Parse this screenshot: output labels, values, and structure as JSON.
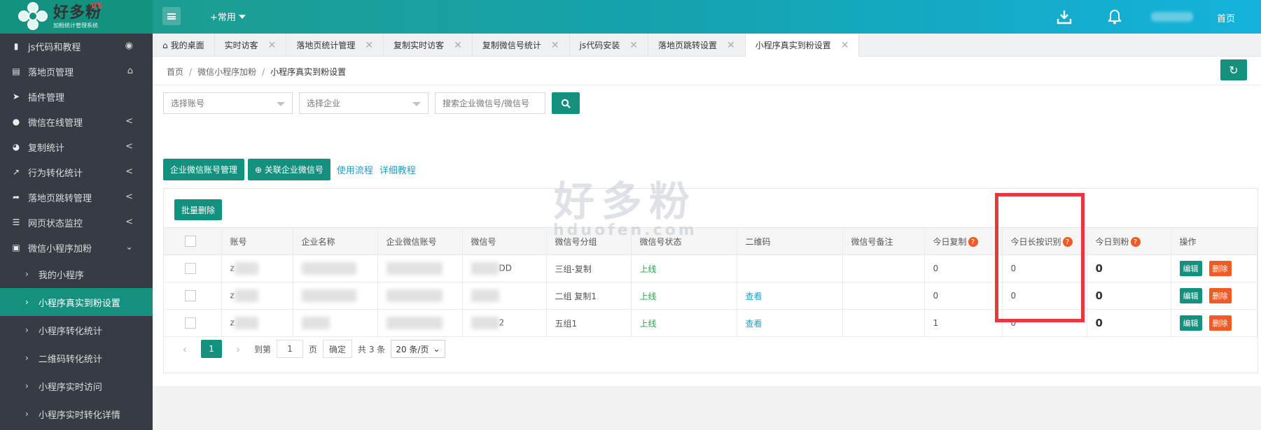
{
  "app": {
    "logo_text": "好多粉",
    "logo_subtitle": "加粉统计管理系统",
    "version": "V5",
    "quick_menu": "+常用",
    "home": "首页"
  },
  "sidebar": {
    "items": [
      {
        "label": "js代码和教程",
        "icon": "bookmark-icon",
        "right": "eye-icon"
      },
      {
        "label": "落地页管理",
        "icon": "page-icon",
        "right": "home-icon"
      },
      {
        "label": "插件管理",
        "icon": "paper-plane-icon"
      },
      {
        "label": "微信在线管理",
        "icon": "wechat-icon",
        "right": "<"
      },
      {
        "label": "复制统计",
        "icon": "pie-chart-icon",
        "right": "<"
      },
      {
        "label": "行为转化统计",
        "icon": "line-chart-icon",
        "right": "<"
      },
      {
        "label": "落地页跳转管理",
        "icon": "share-icon",
        "right": "<"
      },
      {
        "label": "网页状态监控",
        "icon": "list-icon",
        "right": "<"
      },
      {
        "label": "微信小程序加粉",
        "icon": "mini-program-icon",
        "right": "⌄"
      }
    ],
    "subitems": [
      {
        "label": "我的小程序",
        "active": false
      },
      {
        "label": "小程序真实到粉设置",
        "active": true
      },
      {
        "label": "小程序转化统计",
        "active": false
      },
      {
        "label": "二维码转化统计",
        "active": false
      },
      {
        "label": "小程序实时访问",
        "active": false
      },
      {
        "label": "小程序实时转化详情",
        "active": false
      }
    ]
  },
  "tabs": [
    {
      "label": "我的桌面",
      "closable": false
    },
    {
      "label": "实时访客",
      "closable": true
    },
    {
      "label": "落地页统计管理",
      "closable": true
    },
    {
      "label": "复制实时访客",
      "closable": true
    },
    {
      "label": "复制微信号统计",
      "closable": true
    },
    {
      "label": "js代码安装",
      "closable": true
    },
    {
      "label": "落地页跳转设置",
      "closable": true
    },
    {
      "label": "小程序真实到粉设置",
      "closable": true,
      "active": true
    }
  ],
  "breadcrumb": {
    "home": "首页",
    "parent": "微信小程序加粉",
    "current": "小程序真实到粉设置",
    "sep": "/"
  },
  "filters": {
    "account_placeholder": "选择账号",
    "company_placeholder": "选择企业",
    "search_placeholder": "搜索企业微信号/微信号"
  },
  "actions": {
    "manage": "企业微信账号管理",
    "link": "⊕ 关联企业微信号",
    "flow": "使用流程",
    "tutorial": "详细教程",
    "batch_delete": "批量删除"
  },
  "table": {
    "columns": [
      "账号",
      "企业名称",
      "企业微信账号",
      "微信号",
      "微信号分组",
      "微信号状态",
      "二维码",
      "微信号备注",
      "今日复制",
      "今日长按识别",
      "今日到粉",
      "操作"
    ],
    "rows": [
      {
        "account": "z",
        "wechat_suffix": "DD",
        "group": "三组-复制",
        "status": "上线",
        "qr": "",
        "note": "",
        "copy": "0",
        "longpress": "0",
        "fans": "0"
      },
      {
        "account": "z",
        "wechat_suffix": "",
        "group": "二组 复制1",
        "status": "上线",
        "qr": "查看",
        "note": "",
        "copy": "0",
        "longpress": "0",
        "fans": "0"
      },
      {
        "account": "z",
        "wechat_suffix": "2",
        "group": "五组1",
        "status": "上线",
        "qr": "查看",
        "note": "",
        "copy": "1",
        "longpress": "0",
        "fans": "0"
      }
    ],
    "edit": "编辑",
    "delete": "删除"
  },
  "pager": {
    "current": "1",
    "goto": "到第",
    "page_input": "1",
    "page_unit": "页",
    "confirm": "确定",
    "total": "共 3 条",
    "page_size": "20 条/页"
  },
  "watermark": {
    "cn": "好多粉",
    "en": "hduofen.com"
  },
  "colors": {
    "primary": "#14907e",
    "danger": "#f15a24",
    "highlight": "#e8373d",
    "sidebar": "#373c44"
  }
}
